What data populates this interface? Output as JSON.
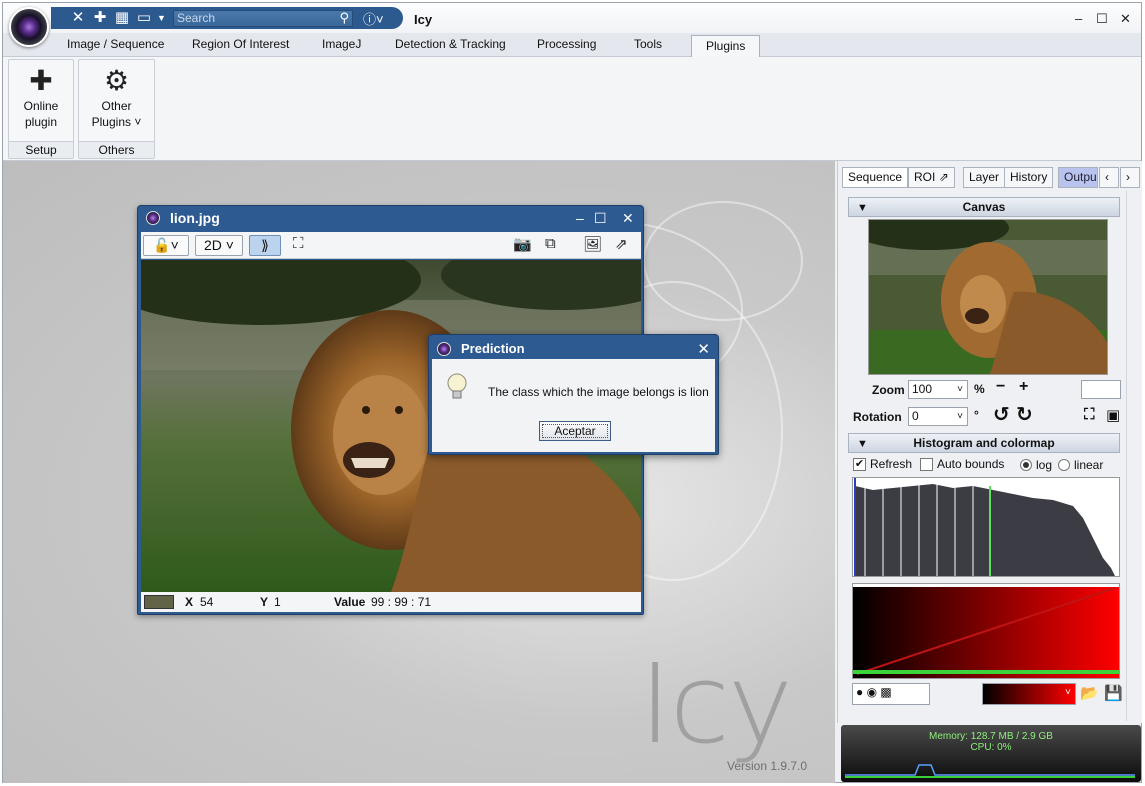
{
  "app": {
    "title": "Icy",
    "search_placeholder": "Search"
  },
  "ribbon_tabs": [
    "Image / Sequence",
    "Region Of Interest",
    "ImageJ",
    "Detection & Tracking",
    "Processing",
    "Tools",
    "Plugins"
  ],
  "active_tab": "Plugins",
  "ribbon_groups": [
    {
      "button_line1": "Online",
      "button_line2": "plugin",
      "label": "Setup",
      "icon": "puzzle-icon"
    },
    {
      "button_line1": "Other",
      "button_line2": "Plugins",
      "label": "Others",
      "icon": "gear-icon"
    }
  ],
  "viewer": {
    "title": "lion.jpg",
    "mode": "2D",
    "status": {
      "x_label": "X",
      "x_value": "54",
      "y_label": "Y",
      "y_value": "1",
      "value_label": "Value",
      "value": "99 : 99 : 71",
      "swatch_color": "#636347"
    }
  },
  "dialog": {
    "title": "Prediction",
    "message": "The class which the image belongs is lion",
    "button": "Aceptar"
  },
  "inspector": {
    "tabs": [
      "Sequence",
      "ROI",
      "Layer",
      "History",
      "Outpu"
    ],
    "canvas_header": "Canvas",
    "zoom_label": "Zoom",
    "zoom_value": "100",
    "zoom_unit": "%",
    "rotation_label": "Rotation",
    "rotation_value": "0",
    "rotation_unit": "°",
    "histogram_header": "Histogram and colormap",
    "refresh_label": "Refresh",
    "refresh_checked": true,
    "autobounds_label": "Auto bounds",
    "log_label": "log",
    "linear_label": "linear",
    "scale_selected": "log"
  },
  "memory": {
    "line1": "Memory: 128.7 MB / 2.9 GB",
    "line2": "CPU: 0%"
  },
  "watermark": {
    "text": "Icy",
    "version": "Version 1.9.7.0"
  }
}
